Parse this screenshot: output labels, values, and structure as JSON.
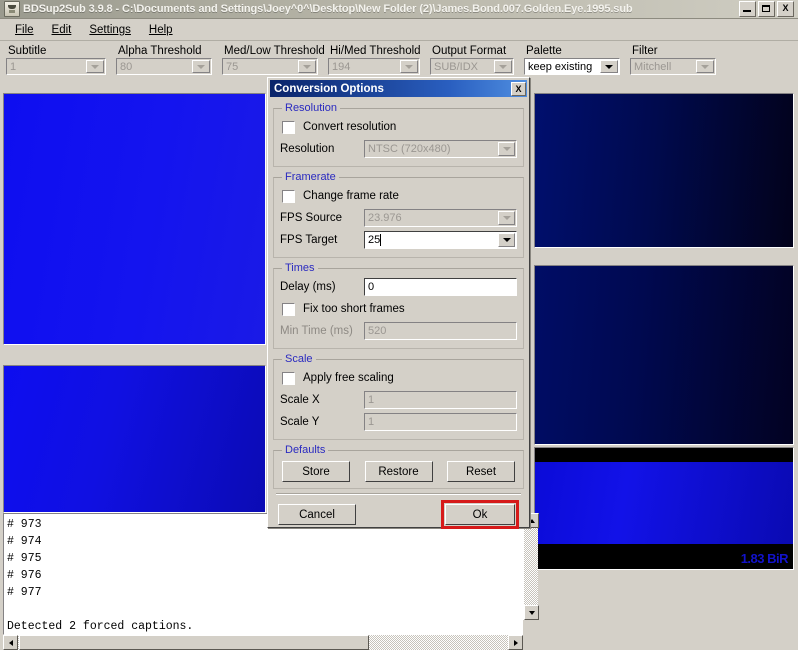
{
  "window": {
    "title": "BDSup2Sub 3.9.8 - C:\\Documents and Settings\\Joey^0^\\Desktop\\New Folder (2)\\James.Bond.007.Golden.Eye.1995.sub",
    "icon": "app-icon",
    "minimize_label": "_",
    "maximize_label": "□",
    "close_label": "X"
  },
  "menubar": {
    "items": [
      {
        "label": "File",
        "mnemonic": "F"
      },
      {
        "label": "Edit",
        "mnemonic": "E"
      },
      {
        "label": "Settings",
        "mnemonic": "S"
      },
      {
        "label": "Help",
        "mnemonic": "H"
      }
    ]
  },
  "toolbar": {
    "controls": [
      {
        "label": "Subtitle",
        "value": "1",
        "enabled": false
      },
      {
        "label": "Alpha Threshold",
        "value": "80",
        "enabled": false
      },
      {
        "label": "Med/Low Threshold",
        "value": "75",
        "enabled": false
      },
      {
        "label": "Hi/Med Threshold",
        "value": "194",
        "enabled": false
      },
      {
        "label": "Output Format",
        "value": "SUB/IDX",
        "enabled": false
      },
      {
        "label": "Palette",
        "value": "keep existing",
        "enabled": true
      },
      {
        "label": "Filter",
        "value": "Mitchell",
        "enabled": false
      }
    ]
  },
  "preview": {
    "left_top_alt": "source-subtitle-preview-bright",
    "left_bottom_alt": "source-subtitle-preview-bright-2",
    "right_top_alt": "target-subtitle-preview-dark",
    "right_bottom_alt": "target-subtitle-preview-dark-2",
    "watermark": "1.83 BiR"
  },
  "log": {
    "lines": [
      "# 973",
      "# 974",
      "# 975",
      "# 976",
      "# 977"
    ],
    "status": "Detected 2 forced captions."
  },
  "dialog": {
    "title": "Conversion Options",
    "close_label": "X",
    "resolution": {
      "legend": "Resolution",
      "convert_checkbox_label": "Convert resolution",
      "convert_checked": false,
      "resolution_label": "Resolution",
      "resolution_value": "NTSC (720x480)",
      "resolution_enabled": false
    },
    "framerate": {
      "legend": "Framerate",
      "change_checkbox_label": "Change frame rate",
      "change_checked": false,
      "fps_source_label": "FPS Source",
      "fps_source_value": "23.976",
      "fps_source_enabled": false,
      "fps_target_label": "FPS Target",
      "fps_target_value": "25",
      "fps_target_enabled": true
    },
    "times": {
      "legend": "Times",
      "delay_label": "Delay (ms)",
      "delay_value": "0",
      "delay_enabled": true,
      "fix_checkbox_label": "Fix too short frames",
      "fix_checked": false,
      "min_time_label": "Min Time (ms)",
      "min_time_value": "520",
      "min_time_enabled": false
    },
    "scale": {
      "legend": "Scale",
      "apply_checkbox_label": "Apply free scaling",
      "apply_checked": false,
      "scale_x_label": "Scale X",
      "scale_x_value": "1",
      "scale_y_label": "Scale Y",
      "scale_y_value": "1",
      "scale_enabled": false
    },
    "defaults": {
      "legend": "Defaults",
      "store_label": "Store",
      "restore_label": "Restore",
      "reset_label": "Reset"
    },
    "cancel_label": "Cancel",
    "ok_label": "Ok",
    "ok_highlight_color": "#d61a1a"
  }
}
